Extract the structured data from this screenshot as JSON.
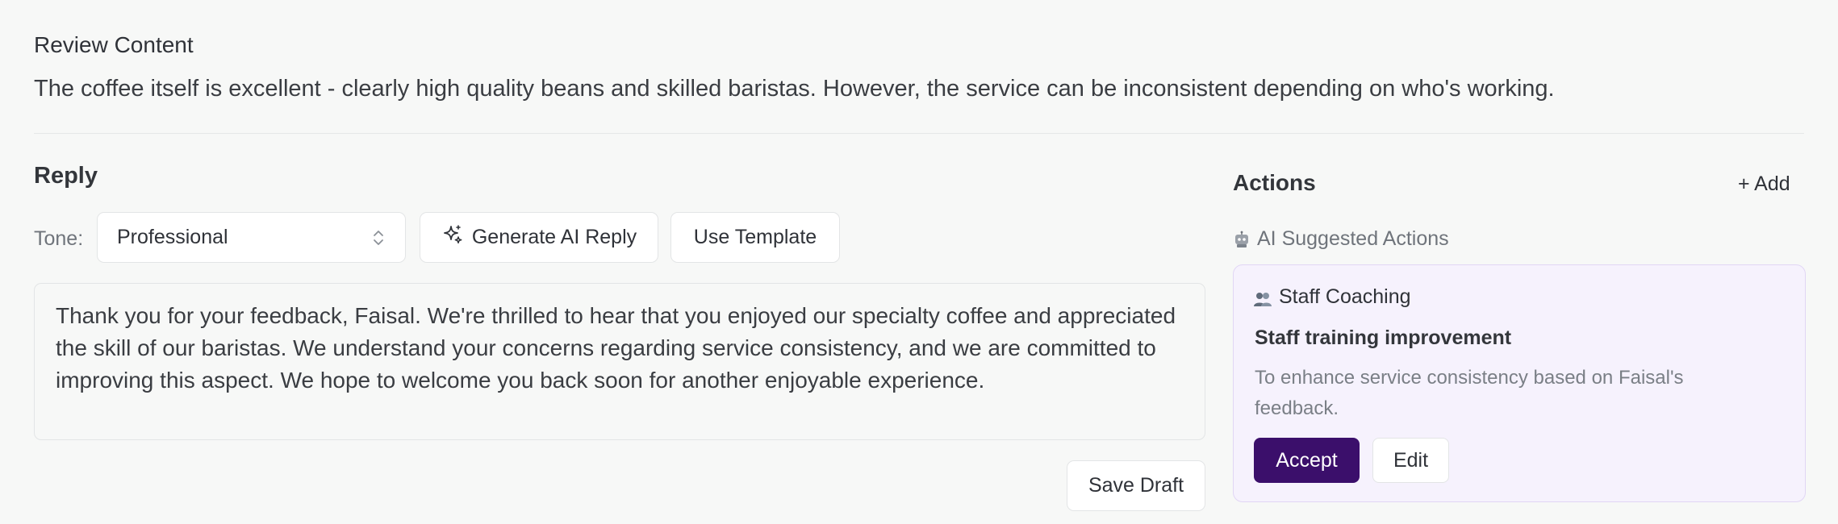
{
  "review": {
    "heading": "Review Content",
    "body": "The coffee itself is excellent - clearly high quality beans and skilled baristas. However, the service can be inconsistent depending on who's working."
  },
  "reply": {
    "heading": "Reply",
    "tone_label": "Tone:",
    "tone_value": "Professional",
    "generate_label": "Generate AI Reply",
    "template_label": "Use Template",
    "text": "Thank you for your feedback, Faisal. We're thrilled to hear that you enjoyed our specialty coffee and appreciated the skill of our baristas. We understand your concerns regarding service consistency, and we are committed to improving this aspect. We hope to welcome you back soon for another enjoyable experience.",
    "save_label": "Save Draft"
  },
  "actions": {
    "heading": "Actions",
    "add_label": "+ Add",
    "ai_suggested_label": "AI Suggested Actions",
    "card": {
      "category": "Staff Coaching",
      "title": "Staff training improvement",
      "description": "To enhance service consistency based on Faisal's feedback.",
      "accept_label": "Accept",
      "edit_label": "Edit"
    }
  },
  "colors": {
    "accent": "#3b0f6b",
    "card_bg": "#f6f2fd",
    "card_border": "#e1d6f5",
    "page_bg": "#f7f8f7"
  },
  "icons": {
    "tone_select": "chevron-up-down-icon",
    "generate": "sparkles-icon",
    "ai_suggested": "robot-icon",
    "category": "people-icon"
  }
}
